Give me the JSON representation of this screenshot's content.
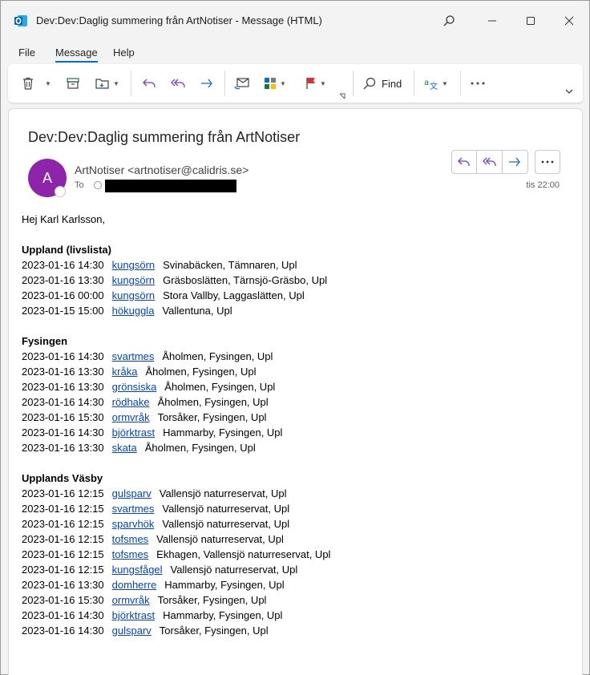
{
  "window": {
    "title": "Dev:Dev:Daglig summering från ArtNotiser  -  Message (HTML)"
  },
  "menu": {
    "items": [
      "File",
      "Message",
      "Help"
    ],
    "active": "Message"
  },
  "ribbon": {
    "find_label": "Find"
  },
  "message": {
    "subject": "Dev:Dev:Daglig summering från ArtNotiser",
    "avatar_initial": "A",
    "avatar_color": "#8e24aa",
    "sender": "ArtNotiser <artnotiser@calidris.se>",
    "to_label": "To",
    "time": "tis 22:00"
  },
  "body": {
    "greeting": "Hej Karl Karlsson,",
    "sections": [
      {
        "title": "Uppland (livslista)",
        "rows": [
          {
            "date": "2023-01-16 14:30",
            "species": "kungsörn",
            "place": "Svinabäcken, Tämnaren, Upl"
          },
          {
            "date": "2023-01-16 13:30",
            "species": "kungsörn",
            "place": "Gräsboslätten, Tärnsjö-Gräsbo, Upl"
          },
          {
            "date": "2023-01-16 00:00",
            "species": "kungsörn",
            "place": "Stora Vallby, Laggaslätten, Upl"
          },
          {
            "date": "2023-01-15 15:00",
            "species": "hökuggla",
            "place": "Vallentuna, Upl"
          }
        ]
      },
      {
        "title": "Fysingen",
        "rows": [
          {
            "date": "2023-01-16 14:30",
            "species": "svartmes",
            "place": "Åholmen, Fysingen, Upl"
          },
          {
            "date": "2023-01-16 13:30",
            "species": "kråka",
            "place": "Åholmen, Fysingen, Upl"
          },
          {
            "date": "2023-01-16 13:30",
            "species": "grönsiska",
            "place": "Åholmen, Fysingen, Upl"
          },
          {
            "date": "2023-01-16 14:30",
            "species": "rödhake",
            "place": "Åholmen, Fysingen, Upl"
          },
          {
            "date": "2023-01-16 15:30",
            "species": "ormvråk",
            "place": "Torsåker, Fysingen, Upl"
          },
          {
            "date": "2023-01-16 14:30",
            "species": "björktrast",
            "place": "Hammarby, Fysingen, Upl"
          },
          {
            "date": "2023-01-16 13:30",
            "species": "skata",
            "place": "Åholmen, Fysingen, Upl"
          }
        ]
      },
      {
        "title": "Upplands Väsby",
        "rows": [
          {
            "date": "2023-01-16 12:15",
            "species": "gulsparv",
            "place": "Vallensjö naturreservat, Upl"
          },
          {
            "date": "2023-01-16 12:15",
            "species": "svartmes",
            "place": "Vallensjö naturreservat, Upl"
          },
          {
            "date": "2023-01-16 12:15",
            "species": "sparvhök",
            "place": "Vallensjö naturreservat, Upl"
          },
          {
            "date": "2023-01-16 12:15",
            "species": "tofsmes",
            "place": "Vallensjö naturreservat, Upl"
          },
          {
            "date": "2023-01-16 12:15",
            "species": "tofsmes",
            "place": "Ekhagen, Vallensjö naturreservat, Upl"
          },
          {
            "date": "2023-01-16 12:15",
            "species": "kungsfågel",
            "place": "Vallensjö naturreservat, Upl"
          },
          {
            "date": "2023-01-16 13:30",
            "species": "domherre",
            "place": "Hammarby, Fysingen, Upl"
          },
          {
            "date": "2023-01-16 15:30",
            "species": "ormvråk",
            "place": "Torsåker, Fysingen, Upl"
          },
          {
            "date": "2023-01-16 14:30",
            "species": "björktrast",
            "place": "Hammarby, Fysingen, Upl"
          },
          {
            "date": "2023-01-16 14:30",
            "species": "gulsparv",
            "place": "Torsåker, Fysingen, Upl"
          }
        ]
      }
    ]
  },
  "colors": {
    "accent": "#0f6cbd",
    "link": "#0645ad",
    "flag": "#d13438"
  }
}
